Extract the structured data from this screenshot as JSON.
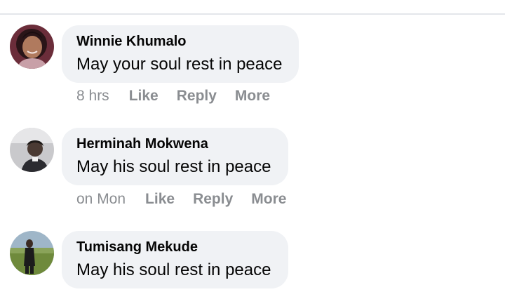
{
  "comments": [
    {
      "author": "Winnie Khumalo",
      "text": "May your soul rest in peace",
      "time": "8 hrs",
      "actions": [
        "Like",
        "Reply",
        "More"
      ]
    },
    {
      "author": "Herminah Mokwena",
      "text": "May his soul rest in peace",
      "time": "on Mon",
      "actions": [
        "Like",
        "Reply",
        "More"
      ]
    },
    {
      "author": "Tumisang Mekude",
      "text": "May his soul rest in peace",
      "time": "",
      "actions": []
    }
  ],
  "colors": {
    "bubble": "#f0f2f5",
    "action_text": "#8a8d91",
    "author_text": "#050505"
  }
}
